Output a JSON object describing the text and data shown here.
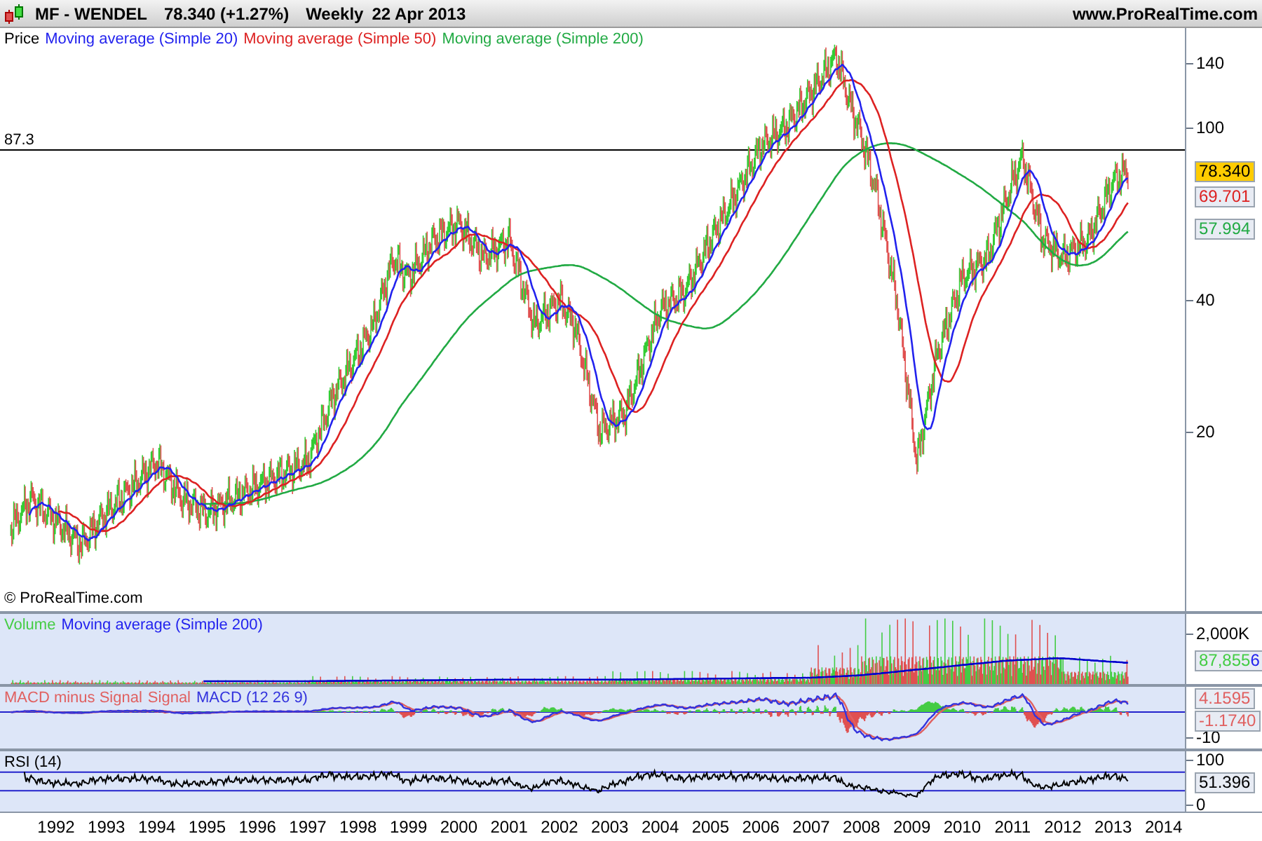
{
  "header": {
    "symbol": "MF - WENDEL",
    "quote": "78.340 (+1.27%)",
    "period": "Weekly",
    "date": "22 Apr 2013",
    "website": "www.ProRealTime.com"
  },
  "price_panel": {
    "legend": [
      {
        "text": "Price",
        "color": "#000000"
      },
      {
        "text": "Moving average (Simple 20)",
        "color": "#2222ee"
      },
      {
        "text": "Moving average (Simple 50)",
        "color": "#dd2222"
      },
      {
        "text": "Moving average (Simple 200)",
        "color": "#22aa44"
      }
    ],
    "reference_line": "87.3",
    "y_ticks": [
      "140",
      "100",
      "40",
      "20"
    ],
    "badges": [
      {
        "text": "78.340",
        "highlighted": true
      },
      {
        "text": "69.701",
        "color": "#dd2222",
        "highlighted": false
      },
      {
        "text": "57.994",
        "color": "#22aa44",
        "highlighted": false
      }
    ],
    "copyright": "© ProRealTime.com"
  },
  "volume_panel": {
    "legend": [
      {
        "text": "Volume",
        "color": "#44cc44"
      },
      {
        "text": "Moving average (Simple 200)",
        "color": "#2222ee"
      }
    ],
    "y_ticks": [
      "2,000K"
    ],
    "badges": [
      {
        "parts": [
          {
            "text": "87,855",
            "color": "#44cc44"
          },
          {
            "text": "6",
            "color": "#2222ee"
          }
        ]
      }
    ]
  },
  "macd_panel": {
    "legend": [
      {
        "text": "MACD minus Signal",
        "color": "#e06060"
      },
      {
        "text": "Signal",
        "color": "#e06060"
      },
      {
        "text": "MACD (12 26 9)",
        "color": "#3333dd"
      }
    ],
    "y_ticks": [
      "-10"
    ],
    "badges": [
      {
        "text": "4.1595",
        "color": "#e06060"
      },
      {
        "text": "-1.1740",
        "color": "#e06060"
      }
    ]
  },
  "rsi_panel": {
    "legend": [
      {
        "text": "RSI (14)",
        "color": "#000000"
      }
    ],
    "y_ticks": [
      "100",
      "0"
    ],
    "badges": [
      {
        "text": "51.396",
        "color": "#000000"
      }
    ]
  },
  "x_axis": {
    "years": [
      "1992",
      "1993",
      "1994",
      "1995",
      "1996",
      "1997",
      "1998",
      "1999",
      "2000",
      "2001",
      "2002",
      "2003",
      "2004",
      "2005",
      "2006",
      "2007",
      "2008",
      "2009",
      "2010",
      "2011",
      "2012",
      "2013",
      "2014"
    ]
  }
}
